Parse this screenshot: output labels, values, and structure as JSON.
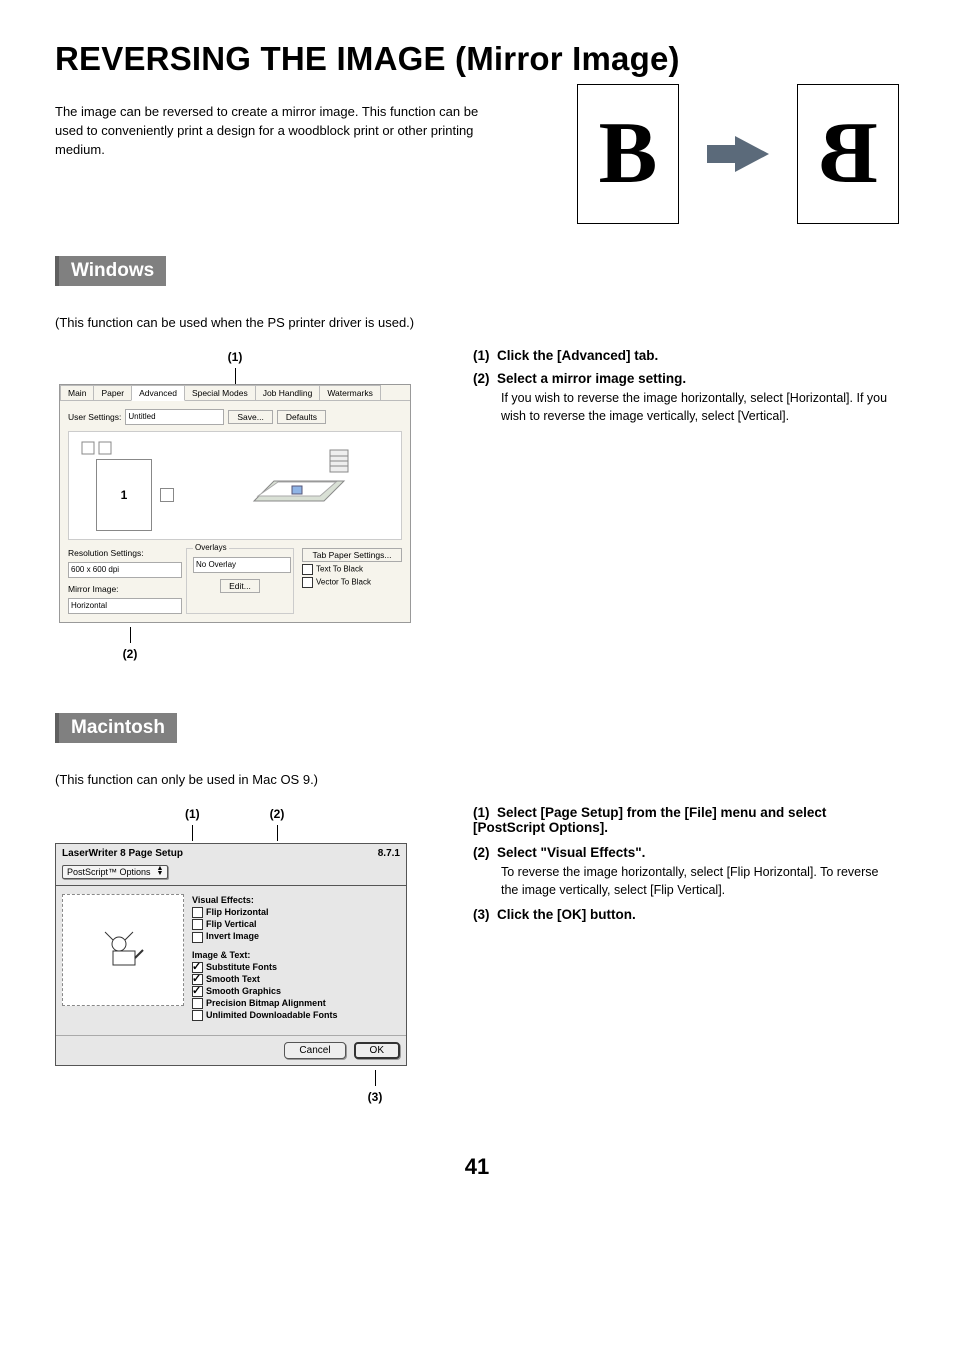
{
  "title": "REVERSING THE IMAGE (Mirror Image)",
  "intro": "The image can be reversed to create a mirror image. This function can be used to conveniently print a design for a woodblock print or other printing medium.",
  "example": {
    "left_letter": "B",
    "right_letter": "B"
  },
  "windows": {
    "heading": "Windows",
    "note": "(This function can be used when the PS printer driver is used.)",
    "callouts": {
      "c1": "(1)",
      "c2": "(2)"
    },
    "dialog": {
      "tabs": [
        "Main",
        "Paper",
        "Advanced",
        "Special Modes",
        "Job Handling",
        "Watermarks"
      ],
      "active_tab_index": 2,
      "user_settings_label": "User Settings:",
      "user_settings_value": "Untitled",
      "save_btn": "Save...",
      "defaults_btn": "Defaults",
      "preview_number": "1",
      "resolution_label": "Resolution Settings:",
      "resolution_value": "600 x 600 dpi",
      "mirror_label": "Mirror Image:",
      "mirror_value": "Horizontal",
      "overlays_legend": "Overlays",
      "overlays_value": "No Overlay",
      "overlays_edit": "Edit...",
      "tab_paper_btn": "Tab Paper Settings...",
      "text_to_black": "Text To Black",
      "vector_to_black": "Vector To Black"
    },
    "steps": {
      "s1_num": "(1)",
      "s1_title": "Click the [Advanced] tab.",
      "s2_num": "(2)",
      "s2_title": "Select a mirror image setting.",
      "s2_body": "If you wish to reverse the image horizontally, select [Horizontal]. If you wish to reverse the image vertically, select [Vertical]."
    }
  },
  "mac": {
    "heading": "Macintosh",
    "note": "(This function can only be used in Mac OS 9.)",
    "callouts": {
      "c1": "(1)",
      "c2": "(2)",
      "c3": "(3)"
    },
    "dialog": {
      "title": "LaserWriter 8 Page Setup",
      "version": "8.7.1",
      "popup_value": "PostScript™ Options",
      "visual_effects_label": "Visual Effects:",
      "flip_h": "Flip Horizontal",
      "flip_v": "Flip Vertical",
      "invert": "Invert Image",
      "image_text_label": "Image & Text:",
      "sub_fonts": "Substitute Fonts",
      "smooth_text": "Smooth Text",
      "smooth_graphics": "Smooth Graphics",
      "precision": "Precision Bitmap Alignment",
      "unlimited": "Unlimited Downloadable Fonts",
      "cancel_btn": "Cancel",
      "ok_btn": "OK"
    },
    "steps": {
      "s1_num": "(1)",
      "s1_title": "Select [Page Setup] from the [File] menu and select [PostScript Options].",
      "s2_num": "(2)",
      "s2_title": "Select \"Visual Effects\".",
      "s2_body": "To reverse the image horizontally, select [Flip Horizontal]. To reverse the image vertically, select [Flip Vertical].",
      "s3_num": "(3)",
      "s3_title": "Click the [OK] button."
    }
  },
  "page_number": "41"
}
